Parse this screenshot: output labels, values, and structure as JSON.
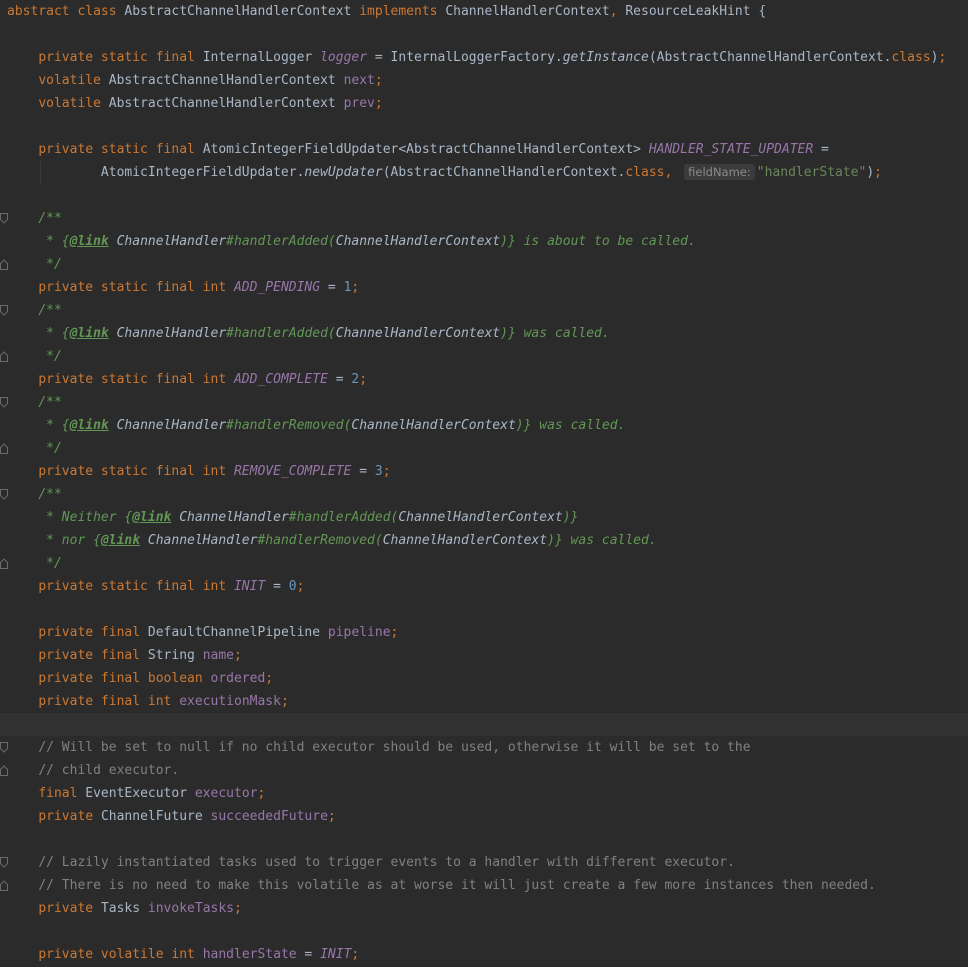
{
  "editor": {
    "language": "java",
    "current_line_index": 31,
    "colors": {
      "background": "#2b2b2b",
      "current_line": "#323232",
      "keyword": "#cc7832",
      "plain": "#a9b7c6",
      "field": "#9876aa",
      "number": "#6897bb",
      "string": "#6a8759",
      "line_comment": "#808080",
      "doc_comment": "#629755",
      "inlay_hint_bg": "#3b3b3b"
    },
    "fold_icons": [
      "fold-start-icon",
      "fold-end-icon",
      "fold-line-icon"
    ],
    "lines": [
      {
        "fold": null,
        "tokens": [
          {
            "t": "kw",
            "v": "abstract class "
          },
          {
            "t": "pl",
            "v": "AbstractChannelHandlerContext "
          },
          {
            "t": "kw",
            "v": "implements "
          },
          {
            "t": "pl",
            "v": "ChannelHandlerContext"
          },
          {
            "t": "pu",
            "v": ", "
          },
          {
            "t": "pl",
            "v": "ResourceLeakHint {"
          }
        ]
      },
      {
        "fold": null,
        "tokens": []
      },
      {
        "fold": null,
        "tokens": [
          {
            "t": "pl",
            "v": "    "
          },
          {
            "t": "kw",
            "v": "private static final "
          },
          {
            "t": "pl",
            "v": "InternalLogger "
          },
          {
            "t": "sf",
            "v": "logger"
          },
          {
            "t": "pl",
            "v": " = InternalLoggerFactory."
          },
          {
            "t": "sm",
            "v": "getInstance"
          },
          {
            "t": "pl",
            "v": "(AbstractChannelHandlerContext."
          },
          {
            "t": "kw",
            "v": "class"
          },
          {
            "t": "pl",
            "v": ")"
          },
          {
            "t": "pu",
            "v": ";"
          }
        ]
      },
      {
        "fold": null,
        "tokens": [
          {
            "t": "pl",
            "v": "    "
          },
          {
            "t": "kw",
            "v": "volatile "
          },
          {
            "t": "pl",
            "v": "AbstractChannelHandlerContext "
          },
          {
            "t": "fi",
            "v": "next"
          },
          {
            "t": "pu",
            "v": ";"
          }
        ]
      },
      {
        "fold": null,
        "tokens": [
          {
            "t": "pl",
            "v": "    "
          },
          {
            "t": "kw",
            "v": "volatile "
          },
          {
            "t": "pl",
            "v": "AbstractChannelHandlerContext "
          },
          {
            "t": "fi",
            "v": "prev"
          },
          {
            "t": "pu",
            "v": ";"
          }
        ]
      },
      {
        "fold": null,
        "tokens": []
      },
      {
        "fold": null,
        "tokens": [
          {
            "t": "pl",
            "v": "    "
          },
          {
            "t": "kw",
            "v": "private static final "
          },
          {
            "t": "pl",
            "v": "AtomicIntegerFieldUpdater<AbstractChannelHandlerContext> "
          },
          {
            "t": "sf",
            "v": "HANDLER_STATE_UPDATER"
          },
          {
            "t": "pl",
            "v": " ="
          }
        ]
      },
      {
        "fold": null,
        "guide": true,
        "tokens": [
          {
            "t": "pl",
            "v": "            AtomicIntegerFieldUpdater."
          },
          {
            "t": "sm",
            "v": "newUpdater"
          },
          {
            "t": "pl",
            "v": "(AbstractChannelHandlerContext."
          },
          {
            "t": "kw",
            "v": "class"
          },
          {
            "t": "pu",
            "v": ", "
          },
          {
            "t": "hint",
            "v": "fieldName:"
          },
          {
            "t": "st",
            "v": "\"handlerState\""
          },
          {
            "t": "pl",
            "v": ")"
          },
          {
            "t": "pu",
            "v": ";"
          }
        ]
      },
      {
        "fold": null,
        "tokens": []
      },
      {
        "fold": "start",
        "tokens": [
          {
            "t": "pl",
            "v": "    "
          },
          {
            "t": "dc",
            "v": "/**"
          }
        ]
      },
      {
        "fold": "line",
        "tokens": [
          {
            "t": "dc",
            "v": "     * {"
          },
          {
            "t": "dt",
            "v": "@link"
          },
          {
            "t": "dc",
            "v": " "
          },
          {
            "t": "dr",
            "v": "ChannelHandler"
          },
          {
            "t": "dc",
            "v": "#handlerAdded("
          },
          {
            "t": "dr",
            "v": "ChannelHandlerContext"
          },
          {
            "t": "dc",
            "v": ")} is about to be called."
          }
        ]
      },
      {
        "fold": "end",
        "tokens": [
          {
            "t": "dc",
            "v": "     */"
          }
        ]
      },
      {
        "fold": null,
        "tokens": [
          {
            "t": "pl",
            "v": "    "
          },
          {
            "t": "kw",
            "v": "private static final int "
          },
          {
            "t": "sf",
            "v": "ADD_PENDING"
          },
          {
            "t": "pl",
            "v": " = "
          },
          {
            "t": "nu",
            "v": "1"
          },
          {
            "t": "pu",
            "v": ";"
          }
        ]
      },
      {
        "fold": "start",
        "tokens": [
          {
            "t": "pl",
            "v": "    "
          },
          {
            "t": "dc",
            "v": "/**"
          }
        ]
      },
      {
        "fold": "line",
        "tokens": [
          {
            "t": "dc",
            "v": "     * {"
          },
          {
            "t": "dt",
            "v": "@link"
          },
          {
            "t": "dc",
            "v": " "
          },
          {
            "t": "dr",
            "v": "ChannelHandler"
          },
          {
            "t": "dc",
            "v": "#handlerAdded("
          },
          {
            "t": "dr",
            "v": "ChannelHandlerContext"
          },
          {
            "t": "dc",
            "v": ")} was called."
          }
        ]
      },
      {
        "fold": "end",
        "tokens": [
          {
            "t": "dc",
            "v": "     */"
          }
        ]
      },
      {
        "fold": null,
        "tokens": [
          {
            "t": "pl",
            "v": "    "
          },
          {
            "t": "kw",
            "v": "private static final int "
          },
          {
            "t": "sf",
            "v": "ADD_COMPLETE"
          },
          {
            "t": "pl",
            "v": " = "
          },
          {
            "t": "nu",
            "v": "2"
          },
          {
            "t": "pu",
            "v": ";"
          }
        ]
      },
      {
        "fold": "start",
        "tokens": [
          {
            "t": "pl",
            "v": "    "
          },
          {
            "t": "dc",
            "v": "/**"
          }
        ]
      },
      {
        "fold": "line",
        "tokens": [
          {
            "t": "dc",
            "v": "     * {"
          },
          {
            "t": "dt",
            "v": "@link"
          },
          {
            "t": "dc",
            "v": " "
          },
          {
            "t": "dr",
            "v": "ChannelHandler"
          },
          {
            "t": "dc",
            "v": "#handlerRemoved("
          },
          {
            "t": "dr",
            "v": "ChannelHandlerContext"
          },
          {
            "t": "dc",
            "v": ")} was called."
          }
        ]
      },
      {
        "fold": "end",
        "tokens": [
          {
            "t": "dc",
            "v": "     */"
          }
        ]
      },
      {
        "fold": null,
        "tokens": [
          {
            "t": "pl",
            "v": "    "
          },
          {
            "t": "kw",
            "v": "private static final int "
          },
          {
            "t": "sf",
            "v": "REMOVE_COMPLETE"
          },
          {
            "t": "pl",
            "v": " = "
          },
          {
            "t": "nu",
            "v": "3"
          },
          {
            "t": "pu",
            "v": ";"
          }
        ]
      },
      {
        "fold": "start",
        "tokens": [
          {
            "t": "pl",
            "v": "    "
          },
          {
            "t": "dc",
            "v": "/**"
          }
        ]
      },
      {
        "fold": "line",
        "tokens": [
          {
            "t": "dc",
            "v": "     * Neither {"
          },
          {
            "t": "dt",
            "v": "@link"
          },
          {
            "t": "dc",
            "v": " "
          },
          {
            "t": "dr",
            "v": "ChannelHandler"
          },
          {
            "t": "dc",
            "v": "#handlerAdded("
          },
          {
            "t": "dr",
            "v": "ChannelHandlerContext"
          },
          {
            "t": "dc",
            "v": ")}"
          }
        ]
      },
      {
        "fold": "line",
        "tokens": [
          {
            "t": "dc",
            "v": "     * nor {"
          },
          {
            "t": "dt",
            "v": "@link"
          },
          {
            "t": "dc",
            "v": " "
          },
          {
            "t": "dr",
            "v": "ChannelHandler"
          },
          {
            "t": "dc",
            "v": "#handlerRemoved("
          },
          {
            "t": "dr",
            "v": "ChannelHandlerContext"
          },
          {
            "t": "dc",
            "v": ")} was called."
          }
        ]
      },
      {
        "fold": "end",
        "tokens": [
          {
            "t": "dc",
            "v": "     */"
          }
        ]
      },
      {
        "fold": null,
        "tokens": [
          {
            "t": "pl",
            "v": "    "
          },
          {
            "t": "kw",
            "v": "private static final int "
          },
          {
            "t": "sf",
            "v": "INIT"
          },
          {
            "t": "pl",
            "v": " = "
          },
          {
            "t": "nu",
            "v": "0"
          },
          {
            "t": "pu",
            "v": ";"
          }
        ]
      },
      {
        "fold": null,
        "tokens": []
      },
      {
        "fold": null,
        "tokens": [
          {
            "t": "pl",
            "v": "    "
          },
          {
            "t": "kw",
            "v": "private final "
          },
          {
            "t": "pl",
            "v": "DefaultChannelPipeline "
          },
          {
            "t": "fi",
            "v": "pipeline"
          },
          {
            "t": "pu",
            "v": ";"
          }
        ]
      },
      {
        "fold": null,
        "tokens": [
          {
            "t": "pl",
            "v": "    "
          },
          {
            "t": "kw",
            "v": "private final "
          },
          {
            "t": "pl",
            "v": "String "
          },
          {
            "t": "fi",
            "v": "name"
          },
          {
            "t": "pu",
            "v": ";"
          }
        ]
      },
      {
        "fold": null,
        "tokens": [
          {
            "t": "pl",
            "v": "    "
          },
          {
            "t": "kw",
            "v": "private final boolean "
          },
          {
            "t": "fi",
            "v": "ordered"
          },
          {
            "t": "pu",
            "v": ";"
          }
        ]
      },
      {
        "fold": null,
        "tokens": [
          {
            "t": "pl",
            "v": "    "
          },
          {
            "t": "kw",
            "v": "private final int "
          },
          {
            "t": "fi",
            "v": "executionMask"
          },
          {
            "t": "pu",
            "v": ";"
          }
        ]
      },
      {
        "fold": null,
        "tokens": []
      },
      {
        "fold": "start",
        "tokens": [
          {
            "t": "pl",
            "v": "    "
          },
          {
            "t": "cm",
            "v": "// Will be set to null if no child executor should be used, otherwise it will be set to the"
          }
        ]
      },
      {
        "fold": "end",
        "tokens": [
          {
            "t": "pl",
            "v": "    "
          },
          {
            "t": "cm",
            "v": "// child executor."
          }
        ]
      },
      {
        "fold": null,
        "tokens": [
          {
            "t": "pl",
            "v": "    "
          },
          {
            "t": "kw",
            "v": "final "
          },
          {
            "t": "pl",
            "v": "EventExecutor "
          },
          {
            "t": "fi",
            "v": "executor"
          },
          {
            "t": "pu",
            "v": ";"
          }
        ]
      },
      {
        "fold": null,
        "tokens": [
          {
            "t": "pl",
            "v": "    "
          },
          {
            "t": "kw",
            "v": "private "
          },
          {
            "t": "pl",
            "v": "ChannelFuture "
          },
          {
            "t": "fi",
            "v": "succeededFuture"
          },
          {
            "t": "pu",
            "v": ";"
          }
        ]
      },
      {
        "fold": null,
        "tokens": []
      },
      {
        "fold": "start",
        "tokens": [
          {
            "t": "pl",
            "v": "    "
          },
          {
            "t": "cm",
            "v": "// Lazily instantiated tasks used to trigger events to a handler with different executor."
          }
        ]
      },
      {
        "fold": "end",
        "tokens": [
          {
            "t": "pl",
            "v": "    "
          },
          {
            "t": "cm",
            "v": "// There is no need to make this volatile as at worse it will just create a few more instances then needed."
          }
        ]
      },
      {
        "fold": null,
        "tokens": [
          {
            "t": "pl",
            "v": "    "
          },
          {
            "t": "kw",
            "v": "private "
          },
          {
            "t": "pl",
            "v": "Tasks "
          },
          {
            "t": "fi",
            "v": "invokeTasks"
          },
          {
            "t": "pu",
            "v": ";"
          }
        ]
      },
      {
        "fold": null,
        "tokens": []
      },
      {
        "fold": null,
        "tokens": [
          {
            "t": "pl",
            "v": "    "
          },
          {
            "t": "kw",
            "v": "private volatile int "
          },
          {
            "t": "fi",
            "v": "handlerState"
          },
          {
            "t": "pl",
            "v": " = "
          },
          {
            "t": "sf",
            "v": "INIT"
          },
          {
            "t": "pu",
            "v": ";"
          }
        ]
      }
    ]
  }
}
